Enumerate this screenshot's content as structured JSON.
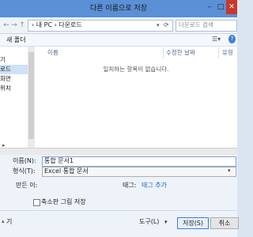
{
  "window": {
    "title": "다른 이름으로 저장"
  },
  "address": {
    "crumbs": "› 내 PC › 다운로드",
    "search_placeholder": "다운로드 검색"
  },
  "toolbar": {
    "new_folder": "새 폴더"
  },
  "nav": {
    "items": [
      {
        "label": "기",
        "selected": false
      },
      {
        "label": "로드",
        "selected": true
      },
      {
        "label": "화면",
        "selected": false
      },
      {
        "label": "위치",
        "selected": false
      }
    ]
  },
  "files": {
    "columns": [
      "이름",
      "수정한 날짜",
      "유형"
    ],
    "empty_message": "일치하는 항목이 없습니다."
  },
  "form": {
    "filename_label": "이름(N):",
    "filename_value": "통합 문서1",
    "filetype_label": "형식(T):",
    "filetype_value": "Excel 통합 문서",
    "author_label": "만든 이:",
    "author_value": "",
    "tags_label": "태그:",
    "tags_link": "태그 추가",
    "thumbnail_label": "축소판 그림 저장",
    "hide_folders": "기",
    "tools_label": "도구(L)",
    "save_label": "저장(S)",
    "cancel_label": "취소"
  },
  "colors": {
    "titlebar": "#5b8fd6",
    "close": "#c7392b",
    "link": "#1f5fbf"
  }
}
